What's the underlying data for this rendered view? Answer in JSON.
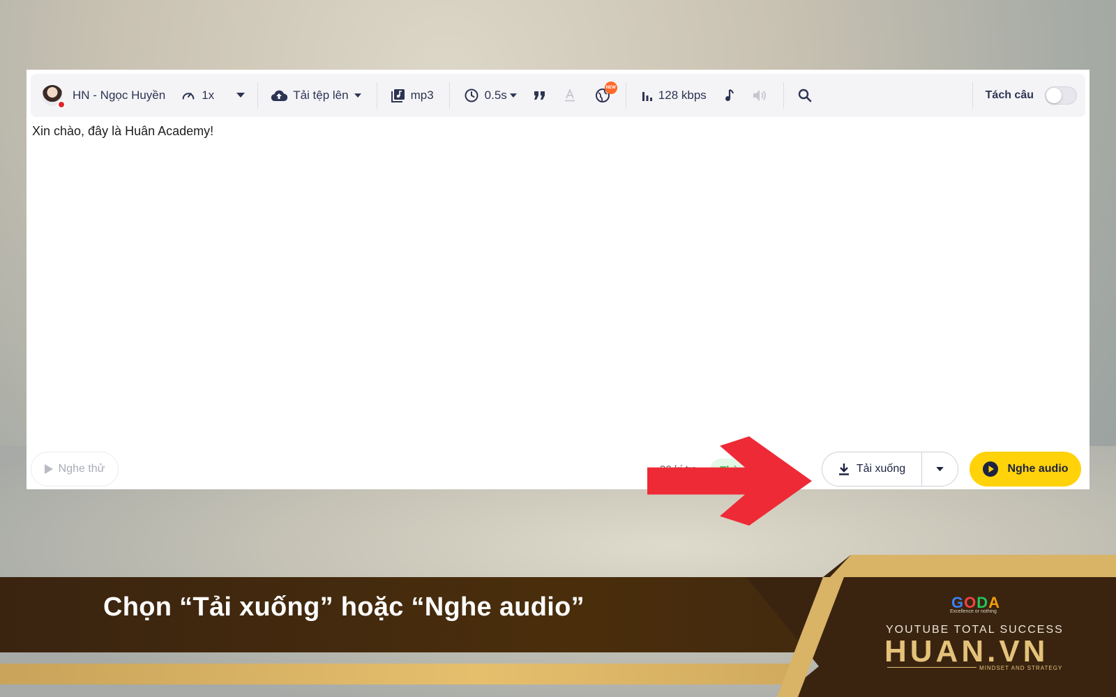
{
  "toolbar": {
    "voice_name": "HN - Ngọc Huyền",
    "speed": "1x",
    "upload_label": "Tải tệp lên",
    "format": "mp3",
    "pause": "0.5s",
    "bitrate": "128 kbps",
    "new_badge": "NEW",
    "split_sentence_label": "Tách câu",
    "split_sentence_enabled": false
  },
  "editor": {
    "text": "Xin chào, đây là Huân Academy!"
  },
  "footer": {
    "preview_label": "Nghe thử",
    "char_count": "30 kí tự",
    "status": "Thành",
    "download_label": "Tải xuống",
    "listen_label": "Nghe audio"
  },
  "banner": {
    "caption": "Chọn “Tải xuống” hoặc “Nghe audio”",
    "goda_letters": [
      "G",
      "O",
      "D",
      "A"
    ],
    "goda_tagline": "Excellence or nothing",
    "tagline": "YOUTUBE TOTAL SUCCESS",
    "brand": "HUAN.VN",
    "brand_sub": "MINDSET AND STRATEGY"
  },
  "colors": {
    "accent_yellow": "#ffd20a",
    "arrow_red": "#ee2a36",
    "banner_brown": "#3a2410",
    "gold": "#e4c27a",
    "toolbar_bg": "#f4f4f7"
  }
}
